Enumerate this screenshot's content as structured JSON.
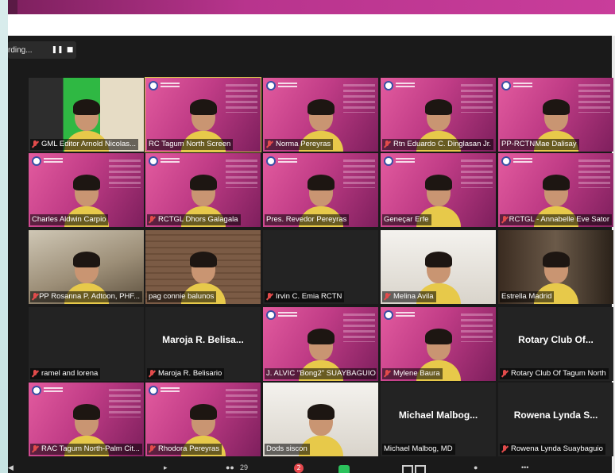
{
  "recording": {
    "status_text": "rding...",
    "pause_icon": "pause-icon",
    "stop_icon": "stop-icon"
  },
  "participants": [
    {
      "name": "GML Editor Arnold Nicolas...",
      "muted": true,
      "video": "green"
    },
    {
      "name": "RC Tagum North Screen",
      "muted": false,
      "video": "pink",
      "active": true
    },
    {
      "name": "Norma Pereyras",
      "muted": true,
      "video": "pink"
    },
    {
      "name": "Rtn Eduardo C. Dinglasan Jr.",
      "muted": true,
      "video": "pink"
    },
    {
      "name": "PP-RCTNMae Dalisay",
      "muted": false,
      "video": "pink"
    },
    {
      "name": "Charles Aldwin Carpio",
      "muted": false,
      "video": "pink"
    },
    {
      "name": "RCTGL Dhors Galagala",
      "muted": true,
      "video": "pink"
    },
    {
      "name": "Pres. Revedor Pereyras",
      "muted": false,
      "video": "pink"
    },
    {
      "name": "Geneçar Erfe",
      "muted": false,
      "video": "pink"
    },
    {
      "name": "RCTGL - Annabelle Eve Sator",
      "muted": true,
      "video": "pink"
    },
    {
      "name": "PP Rosanna P. Adtoon, PHF...",
      "muted": true,
      "video": "room"
    },
    {
      "name": "pag connie balunos",
      "muted": false,
      "video": "brick"
    },
    {
      "name": "Irvin C. Emia RCTN",
      "muted": true,
      "video": "none"
    },
    {
      "name": "Melina Avila",
      "muted": true,
      "video": "white"
    },
    {
      "name": "Estrella Madrid",
      "muted": false,
      "video": "darkroom"
    },
    {
      "name": "ramel and lorena",
      "muted": true,
      "video": "none"
    },
    {
      "name": "Maroja R. Belisario",
      "muted": true,
      "video": "none",
      "avatar_text": "Maroja R. Belisa..."
    },
    {
      "name": "J. ALVIC \"Bong2\" SUAYBAGUIO",
      "muted": false,
      "video": "pink"
    },
    {
      "name": "Mylene Baura",
      "muted": true,
      "video": "pink"
    },
    {
      "name": "Rotary Club Of Tagum North",
      "muted": true,
      "video": "none",
      "avatar_text": "Rotary Club Of..."
    },
    {
      "name": "RAC Tagum North-Palm Cit...",
      "muted": true,
      "video": "pink"
    },
    {
      "name": "Rhodora Pereyras",
      "muted": true,
      "video": "pink"
    },
    {
      "name": "Dods siscon",
      "muted": false,
      "video": "white"
    },
    {
      "name": "Michael Malbog, MD",
      "muted": false,
      "video": "none",
      "avatar_text": "Michael  Malbog..."
    },
    {
      "name": "Rowena Lynda Suaybaguio",
      "muted": true,
      "video": "none",
      "avatar_text": "Rowena Lynda S..."
    }
  ],
  "toolbar": {
    "participants_count": "29",
    "chat_badge": "2"
  },
  "colors": {
    "accent_pink": "#c93d9b",
    "active_outline": "#d8c94b",
    "muted_red": "#e24b4b"
  }
}
